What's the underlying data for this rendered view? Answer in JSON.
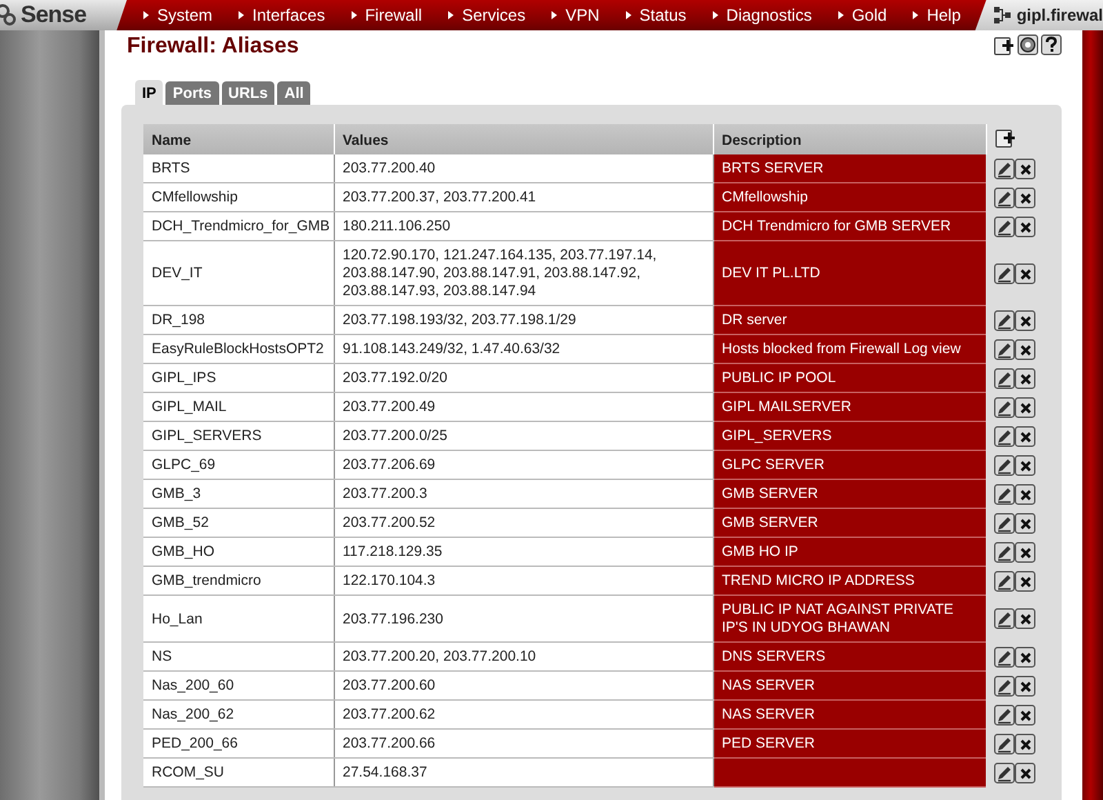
{
  "brand": {
    "logo": "Sense",
    "host": "gipl.firewal"
  },
  "menu": [
    "System",
    "Interfaces",
    "Firewall",
    "Services",
    "VPN",
    "Status",
    "Diagnostics",
    "Gold",
    "Help"
  ],
  "page": {
    "title": "Firewall: Aliases"
  },
  "tabs": [
    {
      "label": "IP",
      "selected": true
    },
    {
      "label": "Ports",
      "selected": false
    },
    {
      "label": "URLs",
      "selected": false
    },
    {
      "label": "All",
      "selected": false
    }
  ],
  "table": {
    "columns": [
      "Name",
      "Values",
      "Description"
    ],
    "rows": [
      {
        "name": "BRTS",
        "values": "203.77.200.40",
        "description": "BRTS SERVER"
      },
      {
        "name": "CMfellowship",
        "values": "203.77.200.37, 203.77.200.41",
        "description": "CMfellowship"
      },
      {
        "name": "DCH_Trendmicro_for_GMB",
        "values": "180.211.106.250",
        "description": "DCH Trendmicro for GMB SERVER"
      },
      {
        "name": "DEV_IT",
        "values": "120.72.90.170, 121.247.164.135, 203.77.197.14, 203.88.147.90, 203.88.147.91, 203.88.147.92, 203.88.147.93, 203.88.147.94",
        "description": "DEV IT PL.LTD"
      },
      {
        "name": "DR_198",
        "values": "203.77.198.193/32, 203.77.198.1/29",
        "description": "DR server"
      },
      {
        "name": "EasyRuleBlockHostsOPT2",
        "values": "91.108.143.249/32, 1.47.40.63/32",
        "description": "Hosts blocked from Firewall Log view"
      },
      {
        "name": "GIPL_IPS",
        "values": "203.77.192.0/20",
        "description": "PUBLIC IP POOL"
      },
      {
        "name": "GIPL_MAIL",
        "values": "203.77.200.49",
        "description": "GIPL MAILSERVER"
      },
      {
        "name": "GIPL_SERVERS",
        "values": "203.77.200.0/25",
        "description": "GIPL_SERVERS"
      },
      {
        "name": "GLPC_69",
        "values": "203.77.206.69",
        "description": "GLPC SERVER"
      },
      {
        "name": "GMB_3",
        "values": "203.77.200.3",
        "description": "GMB SERVER"
      },
      {
        "name": "GMB_52",
        "values": "203.77.200.52",
        "description": "GMB SERVER"
      },
      {
        "name": "GMB_HO",
        "values": "117.218.129.35",
        "description": "GMB HO IP"
      },
      {
        "name": "GMB_trendmicro",
        "values": "122.170.104.3",
        "description": "TREND MICRO IP ADDRESS"
      },
      {
        "name": "Ho_Lan",
        "values": "203.77.196.230",
        "description": "PUBLIC IP NAT AGAINST PRIVATE IP'S IN UDYOG BHAWAN"
      },
      {
        "name": "NS",
        "values": "203.77.200.20, 203.77.200.10",
        "description": "DNS SERVERS"
      },
      {
        "name": "Nas_200_60",
        "values": "203.77.200.60",
        "description": "NAS SERVER"
      },
      {
        "name": "Nas_200_62",
        "values": "203.77.200.62",
        "description": "NAS SERVER"
      },
      {
        "name": "PED_200_66",
        "values": "203.77.200.66",
        "description": "PED SERVER"
      },
      {
        "name": "RCOM_SU",
        "values": "27.54.168.37"
      }
    ]
  }
}
